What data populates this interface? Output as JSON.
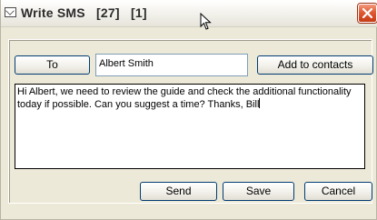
{
  "window": {
    "title": "Write SMS   [27]   [1]",
    "icon": "envelope-icon",
    "close_icon": "close-icon"
  },
  "recipient": {
    "to_label": "To",
    "name": "Albert Smith",
    "add_contacts_label": "Add to contacts"
  },
  "message": {
    "text": "Hi Albert, we need to review the guide and check the additional functionality today if possible. Can you suggest a time? Thanks, Bill"
  },
  "actions": {
    "send_label": "Send",
    "save_label": "Save",
    "cancel_label": "Cancel"
  },
  "colors": {
    "window_bg": "#ece9d8",
    "button_border": "#003c74",
    "close_button": "#e05a33"
  }
}
